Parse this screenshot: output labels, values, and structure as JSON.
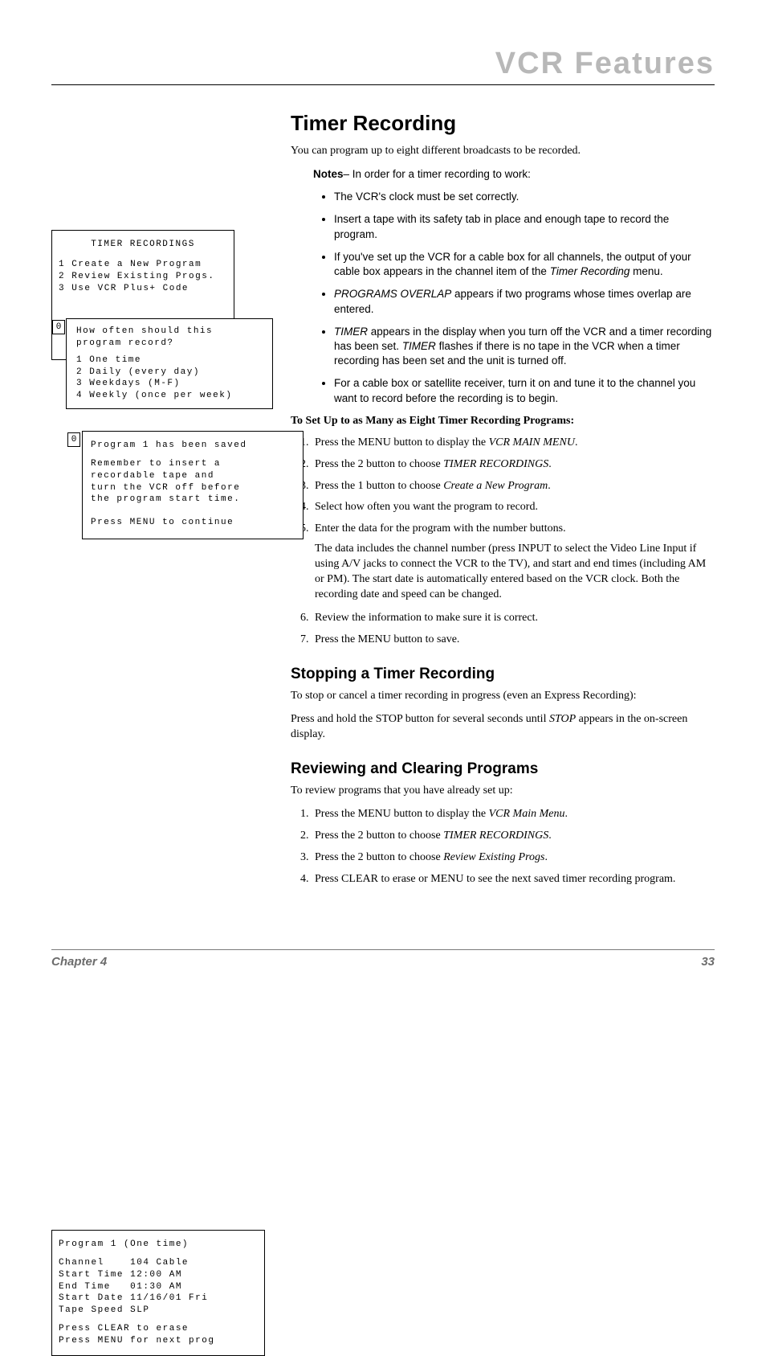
{
  "header": {
    "title": "VCR Features"
  },
  "osd": {
    "menu": {
      "title": "TIMER RECORDINGS",
      "items": [
        "1 Create a New Program",
        "2 Review Existing Progs.",
        "3 Use VCR Plus+ Code"
      ]
    },
    "freq": {
      "marker": "0",
      "question1": "How often should this",
      "question2": "program record?",
      "options": [
        "1 One time",
        "2 Daily (every day)",
        "3 Weekdays (M-F)",
        "4 Weekly (once per week)"
      ]
    },
    "saved": {
      "marker": "0",
      "line1": "Program 1 has been saved",
      "body1": "Remember to insert a",
      "body2": "recordable tape and",
      "body3": "turn the VCR off before",
      "body4": "the program start time.",
      "press": "Press MENU to continue"
    },
    "review": {
      "title": "Program 1 (One time)",
      "rows": [
        "Channel    104 Cable",
        "Start Time 12:00 AM",
        "End Time   01:30 AM",
        "Start Date 11/16/01 Fri",
        "Tape Speed SLP"
      ],
      "foot1": "Press CLEAR to erase",
      "foot2": "Press MENU for next prog"
    }
  },
  "main": {
    "h1": "Timer Recording",
    "intro": "You can program up to eight different broadcasts to be recorded.",
    "notes_lead_b": "Notes",
    "notes_lead_rest": "– In order for a timer recording to work:",
    "notes": [
      {
        "text": "The VCR's clock must be set correctly."
      },
      {
        "text": "Insert a tape with its safety tab in place and enough tape to record the program."
      },
      {
        "pre": "If you've set up the VCR for a cable box for all channels, the output of your cable box appears in the channel item of the ",
        "ital": "Timer Recording",
        "post": " menu."
      },
      {
        "ital": "PROGRAMS OVERLAP",
        "post": " appears if two programs whose times overlap are entered."
      },
      {
        "ital": "TIMER",
        "mid": " appears in the display when you turn off the VCR and a timer recording has been set.  ",
        "ital2": "TIMER",
        "post": " flashes if there is no tape in the VCR when a timer recording has been set and the unit is turned off."
      },
      {
        "text": "For a cable box or satellite receiver, turn it on and tune it to the channel you want to record before the recording is to begin."
      }
    ],
    "setup_head": "To Set Up to as Many as Eight Timer Recording Programs:",
    "steps": [
      {
        "pre": "Press the MENU button to display the ",
        "ital": "VCR MAIN MENU",
        "post": "."
      },
      {
        "pre": "Press the 2 button to choose ",
        "ital": "TIMER RECORDINGS",
        "post": "."
      },
      {
        "pre": "Press the 1 button to choose ",
        "ital": "Create a New Program",
        "post": "."
      },
      {
        "pre": "Select how often you want the program to record."
      },
      {
        "pre": "Enter the data for the program with the number buttons.",
        "extra": "The data includes the channel number (press INPUT to select the Video Line Input if using A/V jacks to connect the VCR to the TV), and start and end times (including AM or PM). The start date is automatically entered based on the VCR clock. Both the recording date and speed can be changed."
      },
      {
        "pre": "Review the information to make sure it is correct."
      },
      {
        "pre": "Press the MENU button to save."
      }
    ],
    "stop_h": "Stopping a Timer Recording",
    "stop_p1": "To stop or cancel a timer recording in progress (even an Express Recording):",
    "stop_p2a": "Press and hold the STOP button for several seconds until ",
    "stop_p2i": "STOP",
    "stop_p2b": " appears in the on-screen display.",
    "rev_h": "Reviewing and Clearing Programs",
    "rev_p": "To review programs that you have already set up:",
    "rev_steps": [
      {
        "pre": "Press the MENU button to display the ",
        "ital": "VCR Main Menu",
        "post": "."
      },
      {
        "pre": "Press the 2 button to choose ",
        "ital": "TIMER RECORDINGS",
        "post": "."
      },
      {
        "pre": "Press the 2 button to choose ",
        "ital": "Review Existing Progs",
        "post": "."
      },
      {
        "pre": "Press CLEAR to erase or MENU to see the next saved timer recording program."
      }
    ]
  },
  "footer": {
    "left": "Chapter 4",
    "right": "33"
  }
}
